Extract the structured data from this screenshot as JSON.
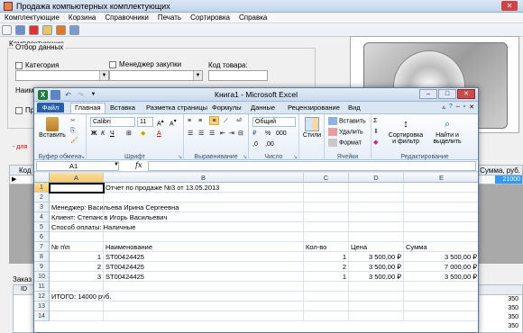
{
  "back_window": {
    "title": "Продажа компьютерных комплектующих",
    "close_label": "✕",
    "menu": [
      "Комплектующие",
      "Корзина",
      "Справочники",
      "Печать",
      "Сортировка",
      "Справка"
    ],
    "section_label": "Комплектующие",
    "filter_group_label": "Отбор данных",
    "category_label": "Категория",
    "manager_label": "Менеджер закупки",
    "code_label": "Код товара:",
    "name_label": "Наимено",
    "pr_label": "Пр",
    "red_hint": "- для",
    "grid_kod_header": "Код",
    "grid_sum_header": "Сумма, руб.",
    "grid_selected_value": "21000",
    "bottom_label": "Заказ",
    "bottom_id_header": "ID",
    "bottom_right_values": [
      "350",
      "350",
      "350",
      "350"
    ]
  },
  "excel": {
    "title": "Книга1 - Microsoft Excel",
    "logo_letter": "X",
    "tabs": {
      "file": "Файл",
      "items": [
        "Главная",
        "Вставка",
        "Разметка страницы",
        "Формулы",
        "Данные",
        "Рецензирование",
        "Вид"
      ],
      "active": "Главная"
    },
    "ribbon": {
      "paste": "Вставить",
      "clipboard_group": "Буфер обмена",
      "font_name": "Calibri",
      "font_size": "11",
      "font_group": "Шрифт",
      "align_group": "Выравнивание",
      "number_format": "Общий",
      "number_group": "Число",
      "styles": "Стили",
      "insert": "Вставить",
      "delete": "Удалить",
      "format": "Формат",
      "cells_group": "Ячейки",
      "sort_filter_1": "Сортировка",
      "sort_filter_2": "и фильтр",
      "find_select_1": "Найти и",
      "find_select_2": "выделить",
      "editing_group": "Редактирование",
      "sum_symbol": "Σ"
    },
    "name_box": "A1",
    "fx_label": "fx",
    "columns": [
      "A",
      "B",
      "C",
      "D",
      "E"
    ],
    "rows": [
      {
        "n": "1",
        "a": "",
        "b": "Отчет по продаже №3  от 13.05.2013",
        "c": "",
        "d": "",
        "e": ""
      },
      {
        "n": "2",
        "a": "",
        "b": "",
        "c": "",
        "d": "",
        "e": ""
      },
      {
        "n": "3",
        "a": "Менеджер: Васильева Ирина Сергеевна",
        "b": "",
        "c": "",
        "d": "",
        "e": ""
      },
      {
        "n": "4",
        "a": "Клиент: Степанов Игорь Васильевич",
        "b": "",
        "c": "",
        "d": "",
        "e": ""
      },
      {
        "n": "5",
        "a": "Способ оплаты: Наличные",
        "b": "",
        "c": "",
        "d": "",
        "e": ""
      },
      {
        "n": "6",
        "a": "",
        "b": "",
        "c": "",
        "d": "",
        "e": ""
      },
      {
        "n": "7",
        "a": "№ п\\п",
        "b": "Наименование",
        "c": "Кол-во",
        "d": "Цена",
        "e": "Сумма"
      },
      {
        "n": "8",
        "a": "1",
        "b": "ST00424425",
        "c": "1",
        "d": "3 500,00 ₽",
        "e": "3 500,00 ₽"
      },
      {
        "n": "9",
        "a": "2",
        "b": "ST00424425",
        "c": "2",
        "d": "3 500,00 ₽",
        "e": "7 000,00 ₽"
      },
      {
        "n": "10",
        "a": "3",
        "b": "ST00424425",
        "c": "1",
        "d": "3 500,00 ₽",
        "e": "3 500,00 ₽"
      },
      {
        "n": "11",
        "a": "",
        "b": "",
        "c": "",
        "d": "",
        "e": ""
      },
      {
        "n": "12",
        "a": "ИТОГО: 14000 руб.",
        "b": "",
        "c": "",
        "d": "",
        "e": ""
      },
      {
        "n": "13",
        "a": "",
        "b": "",
        "c": "",
        "d": "",
        "e": ""
      },
      {
        "n": "14",
        "a": "",
        "b": "",
        "c": "",
        "d": "",
        "e": ""
      }
    ]
  }
}
